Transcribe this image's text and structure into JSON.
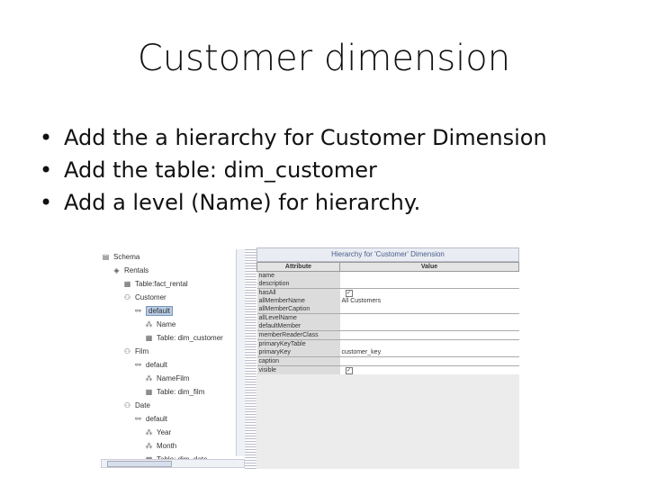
{
  "slide": {
    "title": "Customer dimension",
    "bullets": [
      "Add the a hierarchy for Customer Dimension",
      "Add the table: dim_customer",
      "Add a level (Name) for hierarchy."
    ]
  },
  "tree": [
    {
      "label": "Schema",
      "icon": "schema-icon",
      "depth": 0
    },
    {
      "label": "Rentals",
      "icon": "cube-icon",
      "depth": 1
    },
    {
      "label": "Table:fact_rental",
      "icon": "table-icon",
      "depth": 2
    },
    {
      "label": "Customer",
      "icon": "dimension-icon",
      "depth": 2
    },
    {
      "label": "default",
      "icon": "hierarchy-icon",
      "depth": 3,
      "selected": true
    },
    {
      "label": "Name",
      "icon": "level-icon",
      "depth": 4
    },
    {
      "label": "Table: dim_customer",
      "icon": "table-icon",
      "depth": 4
    },
    {
      "label": "Film",
      "icon": "dimension-icon",
      "depth": 2
    },
    {
      "label": "default",
      "icon": "hierarchy-icon",
      "depth": 3
    },
    {
      "label": "NameFilm",
      "icon": "level-icon",
      "depth": 4
    },
    {
      "label": "Table: dim_film",
      "icon": "table-icon",
      "depth": 4
    },
    {
      "label": "Date",
      "icon": "dimension-icon",
      "depth": 2
    },
    {
      "label": "default",
      "icon": "hierarchy-icon",
      "depth": 3
    },
    {
      "label": "Year",
      "icon": "level-icon",
      "depth": 4
    },
    {
      "label": "Month",
      "icon": "level-icon",
      "depth": 4
    },
    {
      "label": "Table: dim_date",
      "icon": "table-icon",
      "depth": 4
    }
  ],
  "panel": {
    "title": "Hierarchy for 'Customer' Dimension",
    "col_attr": "Attribute",
    "col_value": "Value",
    "rows": [
      {
        "attr": "name",
        "value": ""
      },
      {
        "attr": "description",
        "value": ""
      },
      {
        "attr": "hasAll",
        "value": "",
        "check": true
      },
      {
        "attr": "allMemberName",
        "value": "All Customers"
      },
      {
        "attr": "allMemberCaption",
        "value": ""
      },
      {
        "attr": "allLevelName",
        "value": ""
      },
      {
        "attr": "defaultMember",
        "value": ""
      },
      {
        "attr": "memberReaderClass",
        "value": ""
      },
      {
        "attr": "primaryKeyTable",
        "value": ""
      },
      {
        "attr": "primaryKey",
        "value": "customer_key"
      },
      {
        "attr": "caption",
        "value": ""
      },
      {
        "attr": "visible",
        "value": "",
        "check": true
      }
    ]
  }
}
